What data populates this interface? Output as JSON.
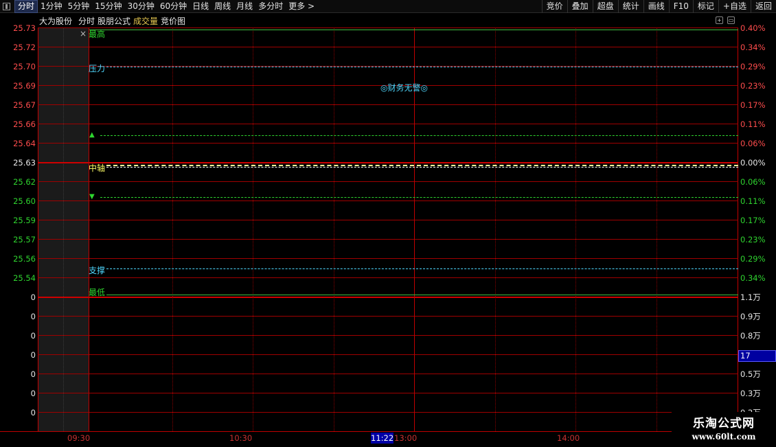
{
  "toolbar": {
    "tabs": [
      "分时",
      "1分钟",
      "5分钟",
      "15分钟",
      "30分钟",
      "60分钟",
      "日线",
      "周线",
      "月线",
      "多分时",
      "更多 >"
    ],
    "right_buttons": [
      "竞价",
      "叠加",
      "超盘",
      "统计",
      "画线",
      "F10",
      "标记",
      "+自选",
      "返回"
    ]
  },
  "subbar": {
    "stock_name": "大为股份",
    "view": "分时",
    "formula": "股朋公式",
    "volume": "成交量",
    "auction": "竞价图"
  },
  "price_axis": {
    "left": [
      "25.73",
      "25.72",
      "25.70",
      "25.69",
      "25.67",
      "25.66",
      "25.64",
      "25.63",
      "25.62",
      "25.60",
      "25.59",
      "25.57",
      "25.56",
      "25.54"
    ],
    "right": [
      "0.40%",
      "0.34%",
      "0.29%",
      "0.23%",
      "0.17%",
      "0.11%",
      "0.06%",
      "0.00%",
      "0.06%",
      "0.11%",
      "0.17%",
      "0.23%",
      "0.29%",
      "0.34%"
    ]
  },
  "volume_axis": {
    "left": [
      "0",
      "0",
      "0",
      "0",
      "0",
      "0",
      "0"
    ],
    "right": [
      "1.1万",
      "0.9万",
      "0.8万",
      "",
      "0.5万",
      "0.3万",
      "0.2万"
    ],
    "cursor_value": "17"
  },
  "markers": {
    "high": "最高",
    "pressure": "压力",
    "mid": "中轴",
    "support": "支撑",
    "low": "最低",
    "up_arrow": "▲",
    "down_arrow": "▼",
    "close": "×"
  },
  "alert_text": "◎财务无警◎",
  "time_axis": {
    "labels": [
      "09:30",
      "10:30",
      "13:00",
      "14:00"
    ],
    "cursor": "11:22"
  },
  "watermark": {
    "title": "乐淘公式网",
    "url": "www.60lt.com"
  },
  "colors": {
    "rise": "#ff4d4d",
    "fall": "#2fd52f",
    "pressure_line": "#4fd8ff",
    "mid_line": "#ffff66",
    "grid": "#c00000",
    "cursor_bg": "#0000a6"
  }
}
